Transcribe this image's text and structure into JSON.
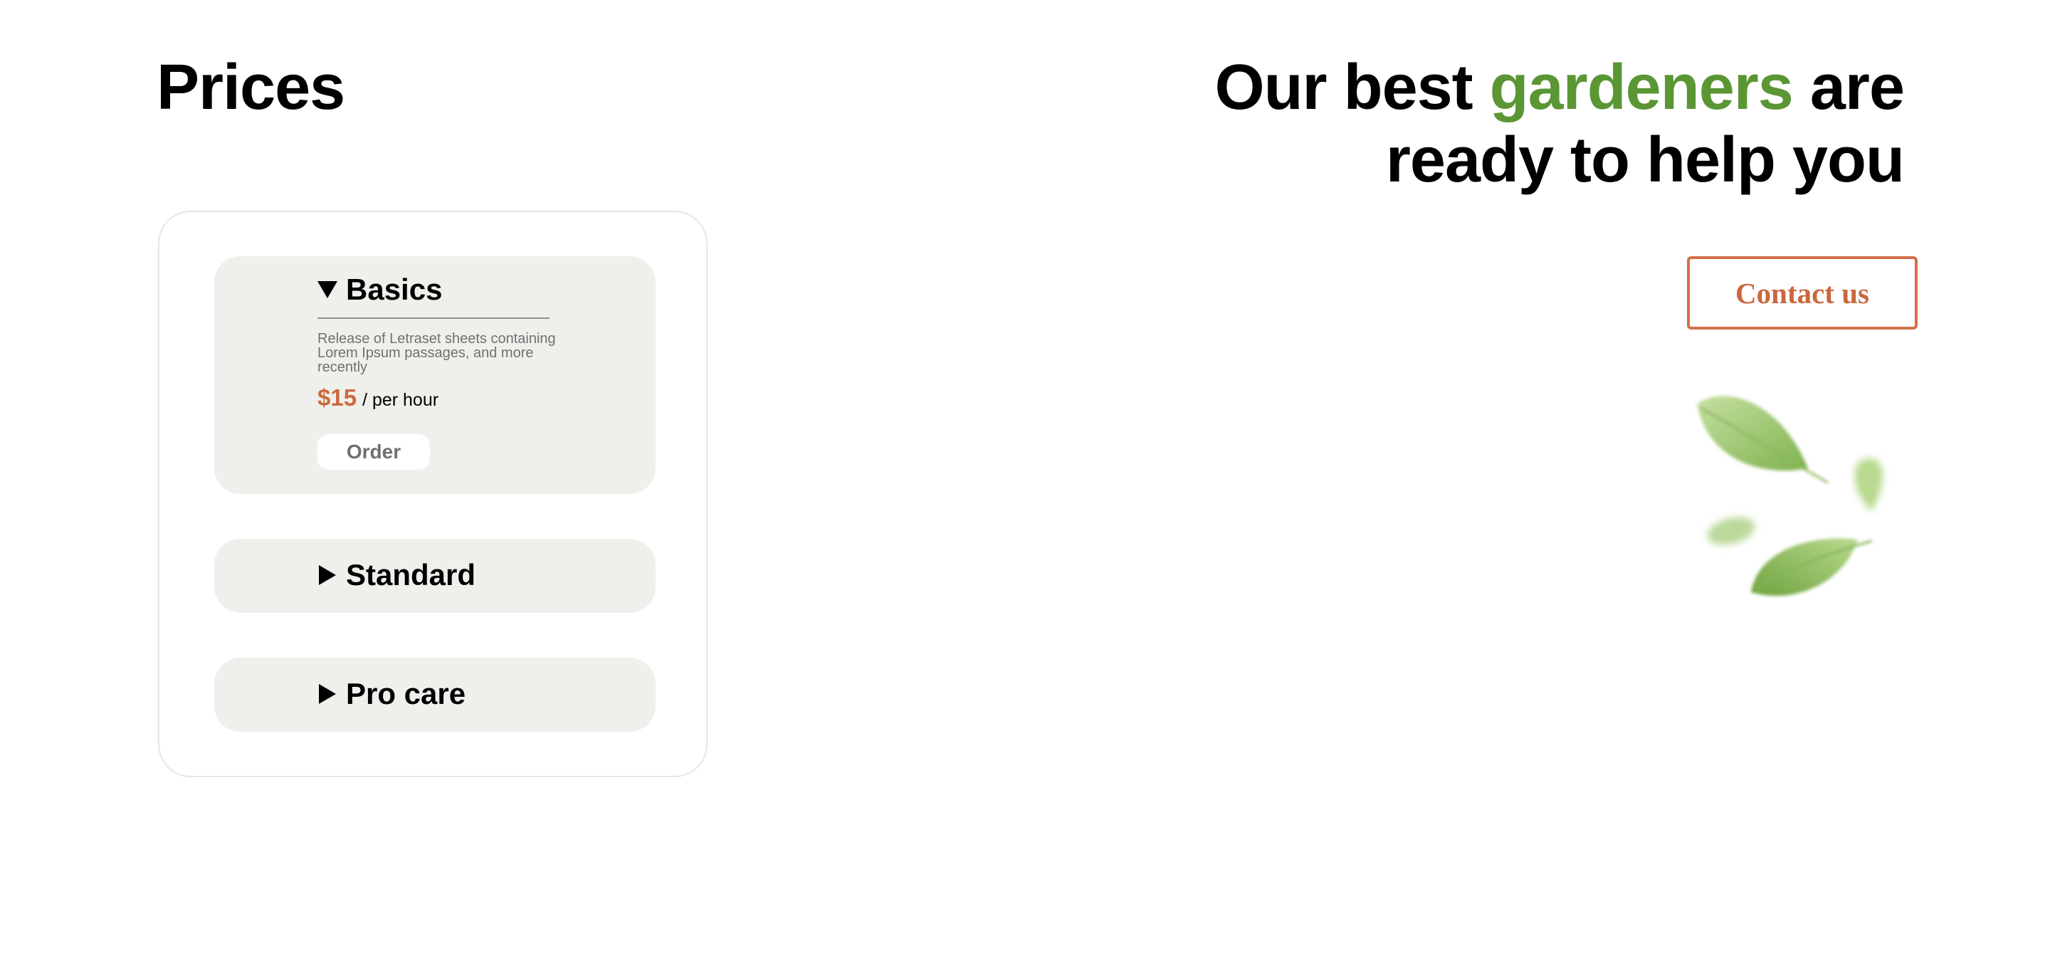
{
  "prices": {
    "title": "Prices",
    "plans": [
      {
        "name": "Basics",
        "expanded": true,
        "description": "Release of Letraset sheets containing Lorem Ipsum passages, and more recently",
        "price": "$15",
        "price_unit": "/ per hour",
        "order_label": "Order"
      },
      {
        "name": "Standard",
        "expanded": false
      },
      {
        "name": "Pro care",
        "expanded": false
      }
    ]
  },
  "hero": {
    "heading_part1": "Our best ",
    "heading_accent": "gardeners",
    "heading_part2": " are",
    "heading_line2": "ready to help you",
    "contact_label": "Contact us",
    "illustration": "falling-leaves"
  },
  "colors": {
    "accent_green": "#5b9635",
    "price_orange": "#c96a3c",
    "contact_border": "#d3704a",
    "plan_background": "#eff0ec"
  }
}
